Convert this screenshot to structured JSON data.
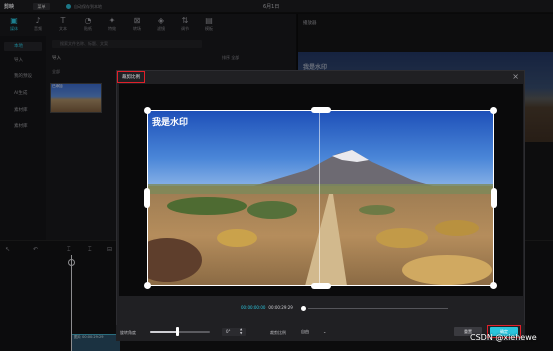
{
  "app": {
    "logo": "剪映",
    "menu_button": "菜单",
    "sync_text": "自动保存到本地",
    "window_title": "6月1日"
  },
  "tools": [
    {
      "icon": "media-icon",
      "glyph": "▣",
      "label": "媒体",
      "active": true
    },
    {
      "icon": "audio-icon",
      "glyph": "♪",
      "label": "音频",
      "active": false
    },
    {
      "icon": "text-icon",
      "glyph": "T",
      "label": "文本",
      "active": false
    },
    {
      "icon": "sticker-icon",
      "glyph": "◔",
      "label": "贴纸",
      "active": false
    },
    {
      "icon": "effects-icon",
      "glyph": "✦",
      "label": "特效",
      "active": false
    },
    {
      "icon": "transition-icon",
      "glyph": "⊠",
      "label": "转场",
      "active": false
    },
    {
      "icon": "filter-icon",
      "glyph": "◈",
      "label": "滤镜",
      "active": false
    },
    {
      "icon": "adjust-icon",
      "glyph": "⇅",
      "label": "调节",
      "active": false
    },
    {
      "icon": "template-icon",
      "glyph": "▤",
      "label": "模板",
      "active": false
    }
  ],
  "sidebar": {
    "items": [
      {
        "label": "本地",
        "active": true
      },
      {
        "label": "导入",
        "active": false
      },
      {
        "label": "我的预设",
        "active": false
      },
      {
        "label": "AI生成",
        "active": false
      },
      {
        "label": "素材库",
        "active": false
      },
      {
        "label": "素材库",
        "active": false
      }
    ]
  },
  "media": {
    "search_placeholder": "搜索文件名称、标题、文案",
    "import_label": "导入",
    "filters": "排序  全部",
    "section_label": "全部",
    "thumb_label": "已添加"
  },
  "player": {
    "title": "播放器",
    "watermark": "我是水印"
  },
  "timeline": {
    "clip_label": "图片 00:00:29:29"
  },
  "dialog": {
    "title": "裁剪比例",
    "close_glyph": "×",
    "watermark_text": "我是水印",
    "time_current": "00:00:00:00",
    "time_total": "00:00:29:29",
    "rotate_label": "旋转角度",
    "rotate_value": "0°",
    "ratio_label": "裁剪比例",
    "ratio_value": "自由",
    "reset_label": "重置",
    "confirm_label": "确定"
  },
  "colors": {
    "accent": "#2bc4dc",
    "highlight_border": "#e0202a"
  },
  "page_watermark": "CSDN @xiehewe"
}
